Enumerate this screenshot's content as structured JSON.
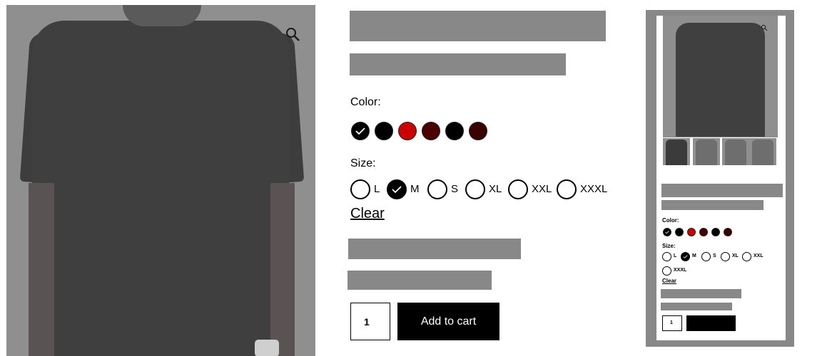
{
  "product": {
    "color_label": "Color:",
    "colors": [
      {
        "name": "black",
        "hex": "#000000",
        "selected": true
      },
      {
        "name": "black-2",
        "hex": "#000000",
        "selected": false
      },
      {
        "name": "red",
        "hex": "#cc0000",
        "selected": false
      },
      {
        "name": "maroon",
        "hex": "#4a0000",
        "selected": false
      },
      {
        "name": "black-3",
        "hex": "#000000",
        "selected": false
      },
      {
        "name": "dark-maroon",
        "hex": "#3a0000",
        "selected": false
      }
    ],
    "size_label": "Size:",
    "sizes": [
      {
        "label": "L",
        "selected": false
      },
      {
        "label": "M",
        "selected": true
      },
      {
        "label": "S",
        "selected": false
      },
      {
        "label": "XL",
        "selected": false
      },
      {
        "label": "XXL",
        "selected": false
      },
      {
        "label": "XXXL",
        "selected": false
      }
    ],
    "clear_label": "Clear",
    "quantity": "1",
    "add_to_cart_label": "Add to cart"
  },
  "mini_preview": {
    "color_label": "Color:",
    "size_label": "Size:",
    "clear_label": "Clear",
    "quantity": "1"
  },
  "icons": {
    "zoom": "magnifier-icon"
  },
  "colors": {
    "placeholder_gray": "#888888",
    "button_black": "#000000"
  }
}
